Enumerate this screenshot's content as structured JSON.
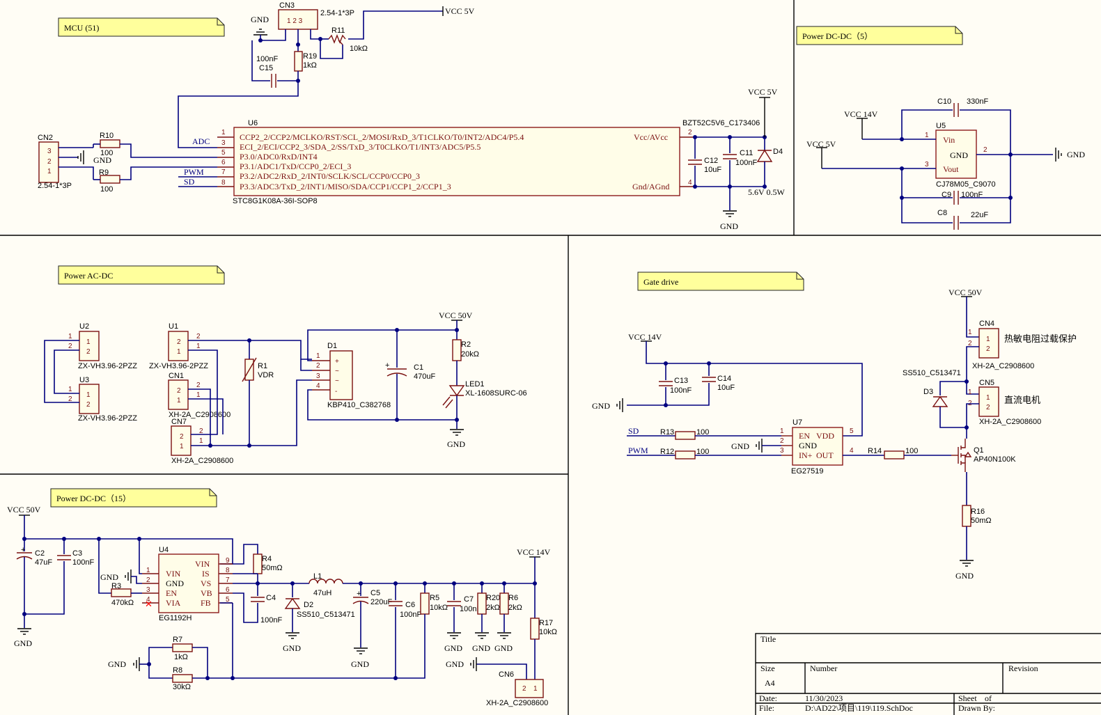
{
  "sections": {
    "mcu": "MCU (51)",
    "dcdc5": "Power DC-DC（5）",
    "acdc": "Power AC-DC",
    "gate": "Gate drive",
    "dcdc15": "Power DC-DC（15）"
  },
  "nets": {
    "vcc5v": "VCC 5V",
    "vcc14v": "VCC 14V",
    "vcc50v": "VCC 50V",
    "gnd": "GND",
    "adc": "ADC",
    "pwm": "PWM",
    "sd": "SD"
  },
  "mcu": {
    "cn3": "CN3",
    "cn3_type": "2.54-1*3P",
    "cn3_pins": "1 2 3",
    "r11": "R11",
    "r11_val": "10kΩ",
    "r19": "R19",
    "r19_val": "1kΩ",
    "c15": "C15",
    "c15_val": "100nF",
    "cn2": "CN2",
    "cn2_type": "2.54-1*3P",
    "r10": "R10",
    "r10_val": "100",
    "r9": "R9",
    "r9_val": "100",
    "u6": "U6",
    "u6_part": "STC8G1K08A-36I-SOP8",
    "u6_pins": [
      "CCP2_2/CCP2/MCLKO/RST/SCL_2/MOSI/RxD_3/T1CLKO/T0/INT2/ADC4/P5.4",
      "ECI_2/ECI/CCP2_3/SDA_2/SS/TxD_3/T0CLKO/T1/INT3/ADC5/P5.5",
      "P3.0/ADC0/RxD/INT4",
      "P3.1/ADC1/TxD/CCP0_2/ECI_3",
      "P3.2/ADC2/RxD_2/INT0/SCLK/SCL/CCP0/CCP0_3",
      "P3.3/ADC3/TxD_2/INT1/MISO/SDA/CCP1/CCP1_2/CCP1_3"
    ],
    "u6_vcc": "Vcc/AVcc",
    "u6_gnd": "Gnd/AGnd",
    "c12": "C12",
    "c12_val": "10uF",
    "c11": "C11",
    "c11_val": "100nF",
    "d4": "D4",
    "d4_part": "BZT52C5V6_C173406",
    "d4_val": "5.6V 0.5W"
  },
  "dcdc5": {
    "u5": "U5",
    "u5_part": "CJ78M05_C9070",
    "vin": "Vin",
    "gnd": "GND",
    "vout": "Vout",
    "c10": "C10",
    "c10_val": "330nF",
    "c9": "C9",
    "c9_val": "100nF",
    "c8": "C8",
    "c8_val": "22uF"
  },
  "acdc": {
    "u2": "U2",
    "u3": "U3",
    "u1": "U1",
    "zx": "ZX-VH3.96-2PZZ",
    "cn1": "CN1",
    "cn7": "CN7",
    "xh": "XH-2A_C2908600",
    "r1": "R1",
    "r1_val": "VDR",
    "d1": "D1",
    "d1_part": "KBP410_C382768",
    "c1": "C1",
    "c1_val": "470uF",
    "r2": "R2",
    "r2_val": "20kΩ",
    "led1": "LED1",
    "led1_part": "XL-1608SURC-06"
  },
  "gate": {
    "c13": "C13",
    "c13_val": "100nF",
    "c14": "C14",
    "c14_val": "10uF",
    "r13": "R13",
    "r13_val": "100",
    "r12": "R12",
    "r12_val": "100",
    "u7": "U7",
    "u7_part": "EG27519",
    "u7_en": "EN",
    "u7_vdd": "VDD",
    "u7_gnd": "GND",
    "u7_in": "IN+",
    "u7_out": "OUT",
    "r14": "R14",
    "r14_val": "100",
    "q1": "Q1",
    "q1_part": "AP40N100K",
    "r16": "R16",
    "r16_val": "50mΩ",
    "d3": "D3",
    "d3_part": "SS510_C513471",
    "cn4": "CN4",
    "cn4_note": "热敏电阻过载保护",
    "cn5": "CN5",
    "cn5_note": "直流电机",
    "xh": "XH-2A_C2908600"
  },
  "dcdc15": {
    "c2": "C2",
    "c2_val": "47uF",
    "c3": "C3",
    "c3_val": "100nF",
    "u4": "U4",
    "u4_part": "EG1192H",
    "u4_l": [
      "VIN",
      "GND",
      "EN",
      "VIA"
    ],
    "u4_r": [
      "VIN",
      "IS",
      "VS",
      "VB",
      "FB"
    ],
    "r3": "R3",
    "r3_val": "470kΩ",
    "r4": "R4",
    "r4_val": "50mΩ",
    "c4": "C4",
    "c4_val": "100nF",
    "l1": "L1",
    "l1_val": "47uH",
    "d2": "D2",
    "d2_part": "SS510_C513471",
    "c5": "C5",
    "c5_val": "220uF",
    "c6": "C6",
    "c6_val": "100nF",
    "r5": "R5",
    "r5_val": "10kΩ",
    "c7": "C7",
    "c7_val": "100nF",
    "r20": "R20",
    "r20_val": "2kΩ",
    "r6": "R6",
    "r6_val": "2kΩ",
    "r17": "R17",
    "r17_val": "10kΩ",
    "r7": "R7",
    "r7_val": "1kΩ",
    "r8": "R8",
    "r8_val": "30kΩ",
    "cn6": "CN6",
    "xh": "XH-2A_C2908600"
  },
  "titleblock": {
    "title": "Title",
    "size": "Size",
    "size_val": "A4",
    "number": "Number",
    "revision": "Revision",
    "date": "Date:",
    "date_val": "11/30/2023",
    "sheet": "Sheet",
    "of": "of",
    "file": "File:",
    "file_val": "D:\\AD22\\项目\\119\\119.SchDoc",
    "drawn": "Drawn By:"
  }
}
